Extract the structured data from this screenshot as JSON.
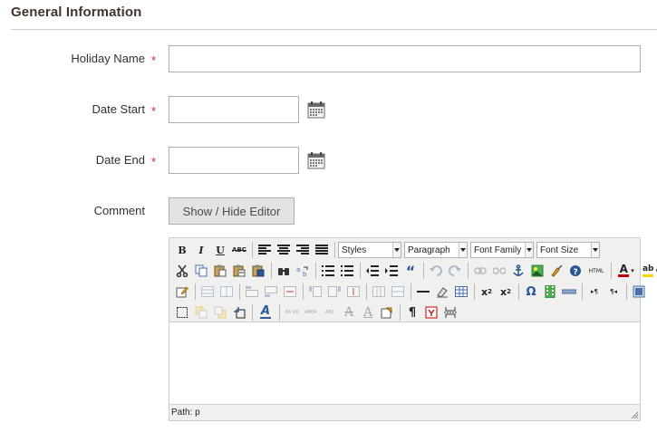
{
  "section": {
    "title": "General Information"
  },
  "form": {
    "holiday_name": {
      "label": "Holiday Name",
      "required_mark": "*",
      "value": ""
    },
    "date_start": {
      "label": "Date Start",
      "required_mark": "*",
      "value": "",
      "icon": "calendar-icon"
    },
    "date_end": {
      "label": "Date End",
      "required_mark": "*",
      "value": "",
      "icon": "calendar-icon"
    },
    "comment": {
      "label": "Comment",
      "toggle_label": "Show / Hide Editor"
    }
  },
  "editor": {
    "selects": {
      "styles": "Styles",
      "format": "Paragraph",
      "font_family": "Font Family",
      "font_size": "Font Size"
    },
    "buttons": {
      "bold": "B",
      "italic": "I",
      "underline": "U",
      "strikethrough": "ABC",
      "blockquote": "“",
      "html": "HTML",
      "subscript": "x",
      "superscript": "x",
      "sub_mark": "2",
      "sup_mark": "2",
      "charmap": "Ω",
      "ltr": "▸¶",
      "rtl": "¶◂",
      "visualchars": "¶",
      "forecolor": "A",
      "backcolor": "ab",
      "styleprops": "A",
      "cite": "66 99",
      "abbr": "ABBR",
      "acronym": "ABC",
      "del": "A",
      "ins": "A"
    },
    "statusbar": {
      "path": "Path: p"
    },
    "colors": {
      "forecolor": "#c00000",
      "backcolor": "#ffd700"
    }
  }
}
